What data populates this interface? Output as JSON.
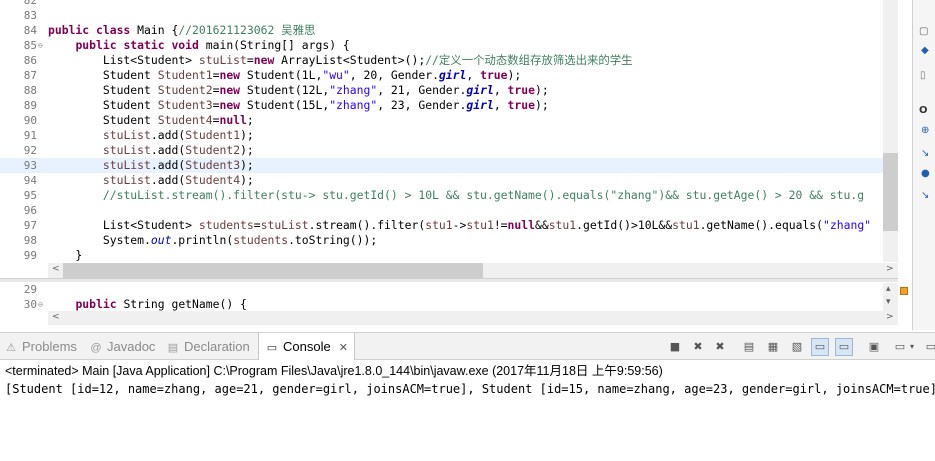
{
  "editor": {
    "lines": [
      {
        "n": "82",
        "html": ""
      },
      {
        "n": "83",
        "html": ""
      },
      {
        "n": "84",
        "html": "<span class=\"kw\">public class</span> Main {<span class=\"cmt\">//201621123062 吴雅思</span>"
      },
      {
        "n": "85",
        "fold": true,
        "html": "    <span class=\"kw\">public static void</span> main(String[] args) {"
      },
      {
        "n": "86",
        "html": "        List&lt;Student&gt; <span class=\"var\">stuList</span>=<span class=\"kw\">new</span> ArrayList&lt;Student&gt;();<span class=\"cmt\">//定义一个动态数组存放筛选出来的学生</span>"
      },
      {
        "n": "87",
        "html": "        Student <span class=\"var\">Student1</span>=<span class=\"kw\">new</span> Student(1L,<span class=\"str\">\"wu\"</span>, 20, Gender.<span class=\"fld\">girl</span>, <span class=\"kw\">true</span>);"
      },
      {
        "n": "88",
        "html": "        Student <span class=\"var\">Student2</span>=<span class=\"kw\">new</span> Student(12L,<span class=\"str\">\"zhang\"</span>, 21, Gender.<span class=\"fld\">girl</span>, <span class=\"kw\">true</span>);"
      },
      {
        "n": "89",
        "html": "        Student <span class=\"var\">Student3</span>=<span class=\"kw\">new</span> Student(15L,<span class=\"str\">\"zhang\"</span>, 23, Gender.<span class=\"fld\">girl</span>, <span class=\"kw\">true</span>);"
      },
      {
        "n": "90",
        "html": "        Student <span class=\"var\">Student4</span>=<span class=\"kw\">null</span>;"
      },
      {
        "n": "91",
        "html": "        <span class=\"var\">stuList</span>.add(<span class=\"var\">Student1</span>);"
      },
      {
        "n": "92",
        "html": "        <span class=\"var\">stuList</span>.add(<span class=\"var\">Student2</span>);"
      },
      {
        "n": "93",
        "hl": true,
        "html": "        <span class=\"var\">stuList</span>.add(<span class=\"var\">Student3</span>);"
      },
      {
        "n": "94",
        "html": "        <span class=\"var\">stuList</span>.add(<span class=\"var\">Student4</span>);"
      },
      {
        "n": "95",
        "html": "        <span class=\"cmt\">//stuList.stream().filter(stu-&gt; stu.getId() &gt; 10L &amp;&amp; stu.getName().equals(\"zhang\")&amp;&amp; stu.getAge() &gt; 20 &amp;&amp; stu.g</span>"
      },
      {
        "n": "96",
        "html": ""
      },
      {
        "n": "97",
        "html": "        List&lt;Student&gt; <span class=\"var\">students</span>=<span class=\"var\">stuList</span>.stream().filter(<span class=\"var\">stu1</span>-&gt;<span class=\"var\">stu1</span>!=<span class=\"kw\">null</span>&amp;&amp;<span class=\"var\">stu1</span>.getId()&gt;10L&amp;&amp;<span class=\"var\">stu1</span>.getName().equals(<span class=\"str\">\"zhang\"</span>"
      },
      {
        "n": "98",
        "html": "        System.<span class=\"fldi\">out</span>.println(<span class=\"var\">students</span>.toString());"
      },
      {
        "n": "99",
        "html": "    }"
      }
    ],
    "lines2": [
      {
        "n": "29",
        "html": ""
      },
      {
        "n": "30",
        "fold": true,
        "html": "    <span class=\"kw\">public</span> String getName() {"
      }
    ]
  },
  "tabs": [
    {
      "label": "Problems",
      "icon": "⚠",
      "name": "problems",
      "active": false
    },
    {
      "label": "Javadoc",
      "icon": "@",
      "name": "javadoc",
      "active": false
    },
    {
      "label": "Declaration",
      "icon": "▤",
      "name": "declaration",
      "active": false
    },
    {
      "label": "Console",
      "icon": "▭",
      "name": "console",
      "active": true
    }
  ],
  "console": {
    "terminated": "<terminated> Main [Java Application] C:\\Program Files\\Java\\jre1.8.0_144\\bin\\javaw.exe (2017年11月18日 上午9:59:56)",
    "output": "[Student [id=12, name=zhang, age=21, gender=girl, joinsACM=true], Student [id=15, name=zhang, age=23, gender=girl, joinsACM=true]]"
  },
  "colors": {
    "keyword": "#7f0055",
    "string": "#2a00ff",
    "comment": "#3f7f5f",
    "field": "#0000c0",
    "highlight": "#e8f2fe"
  }
}
